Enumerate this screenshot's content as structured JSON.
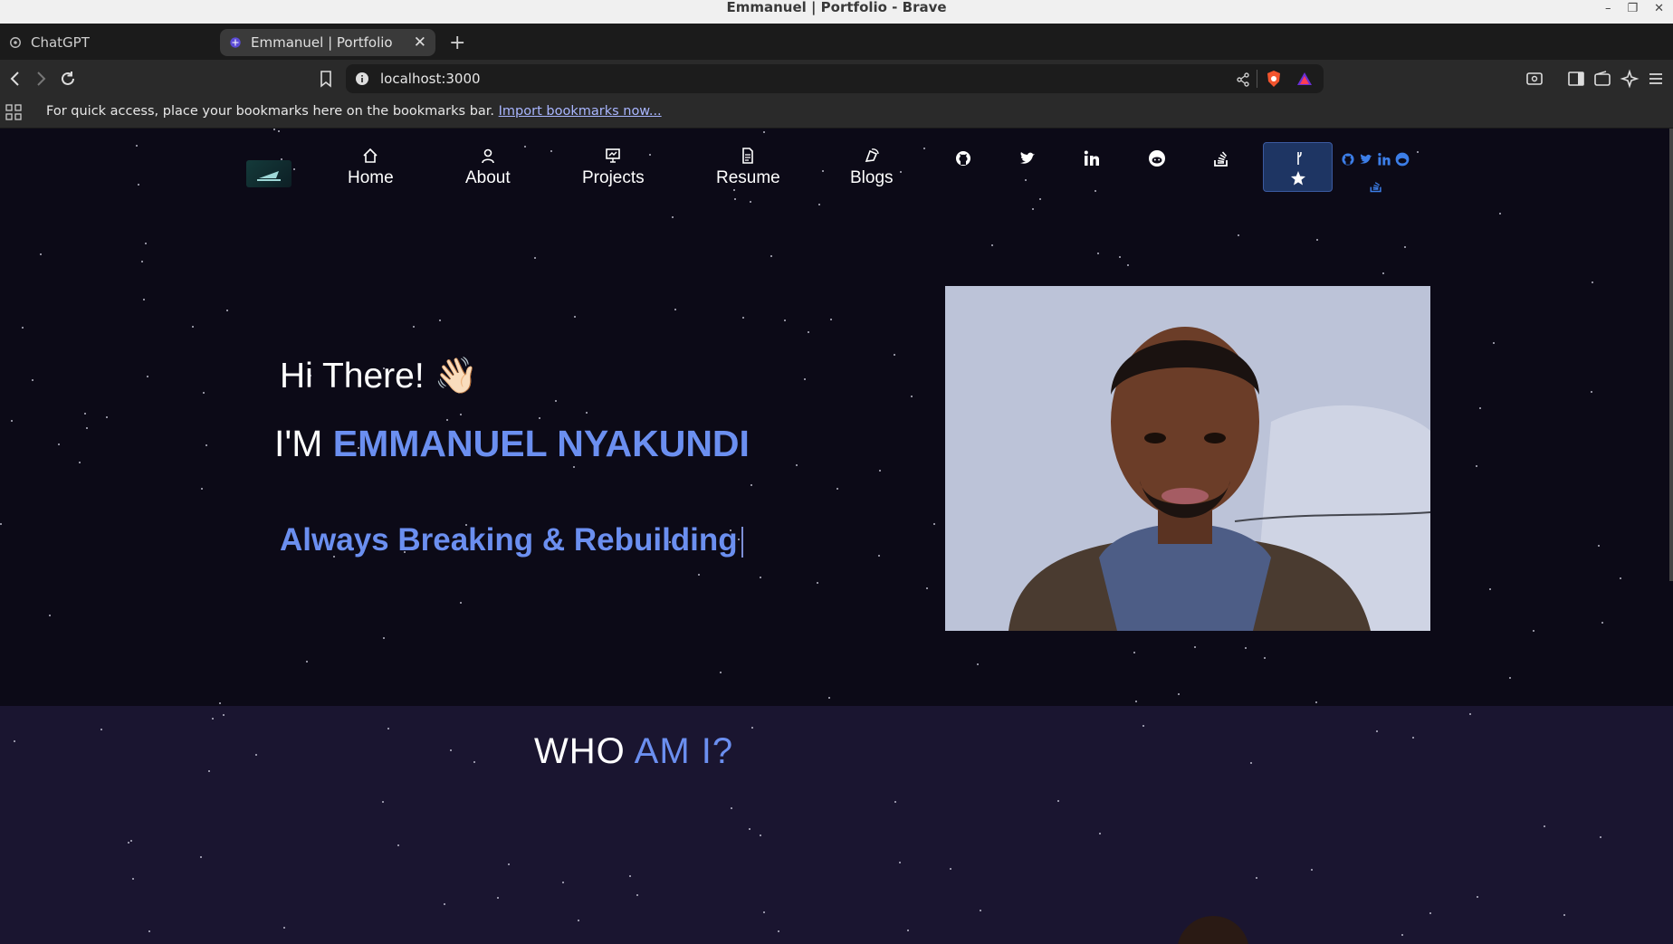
{
  "window": {
    "title": "Emmanuel | Portfolio - Brave",
    "controls": [
      "–",
      "❐",
      "✕"
    ]
  },
  "tabs": [
    {
      "label": "ChatGPT",
      "icon": "openai-icon",
      "active": false
    },
    {
      "label": "Emmanuel | Portfolio",
      "icon": "portfolio-favicon",
      "active": true
    }
  ],
  "tab_close": "✕",
  "new_tab": "+",
  "address_bar": {
    "url": "localhost:3000"
  },
  "bookmarks_bar": {
    "message": "For quick access, place your bookmarks here on the bookmarks bar.",
    "link": "Import bookmarks now..."
  },
  "nav": {
    "items": [
      {
        "label": "Home",
        "icon": "home-icon"
      },
      {
        "label": "About",
        "icon": "user-icon"
      },
      {
        "label": "Projects",
        "icon": "presentation-icon"
      },
      {
        "label": "Resume",
        "icon": "document-icon"
      },
      {
        "label": "Blogs",
        "icon": "pen-icon"
      }
    ],
    "socials": [
      "github-icon",
      "twitter-icon",
      "linkedin-icon",
      "reddit-icon",
      "stackoverflow-icon"
    ]
  },
  "hero": {
    "greeting": "Hi There!",
    "wave_emoji": "👋🏻",
    "im_prefix": "I'M",
    "name": "EMMANUEL NYAKUNDI",
    "typewriter": "Always Breaking & Rebuilding"
  },
  "about": {
    "heading_plain": "WHO",
    "heading_highlight": "AM I?"
  },
  "colors": {
    "accent": "#6b8ff0",
    "background": "#0c0a17",
    "about_background": "#1a1530"
  }
}
